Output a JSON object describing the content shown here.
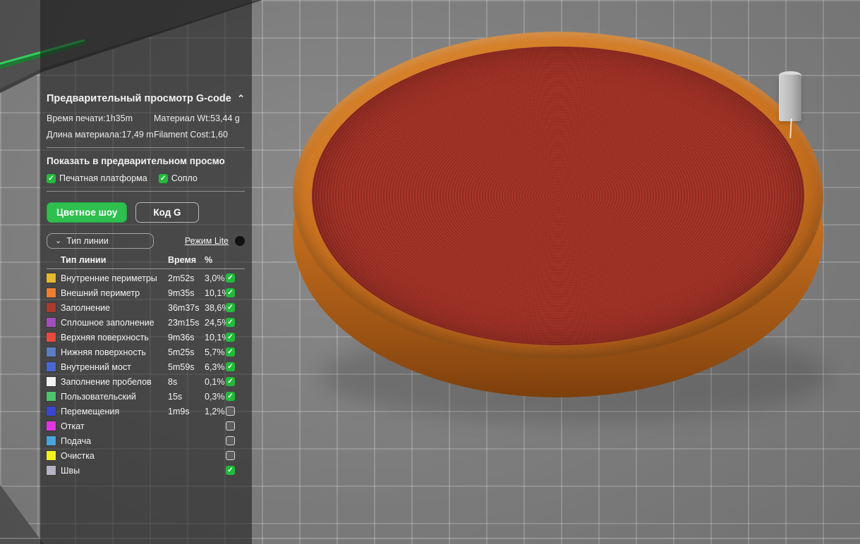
{
  "panel": {
    "title": "Предварительный просмотр G-code",
    "stats": {
      "print_time_label": "Время печати:",
      "print_time": "1h35m",
      "material_wt_label": "Материал Wt:",
      "material_wt": "53,44 g",
      "material_len_label": "Длина материала:",
      "material_len": "17,49 m",
      "filament_cost_label": "Filament Cost:",
      "filament_cost": "1,60"
    },
    "show_in_preview": {
      "heading": "Показать в предварительном просмо",
      "options": [
        {
          "label": "Печатная платформа",
          "checked": true
        },
        {
          "label": "Сопло",
          "checked": true
        }
      ]
    },
    "buttons": {
      "color_show": "Цветное шоу",
      "gcode": "Код G"
    },
    "line_type_dropdown": "Тип линии",
    "mode_lite": "Режим Lite",
    "accent_green": "#23ba3b",
    "button_green": "#2fbf4f",
    "table": {
      "headers": [
        "Тип линии",
        "Время",
        "%"
      ],
      "rows": [
        {
          "color": "#e5b92c",
          "label": "Внутренние периметры",
          "time": "2m52s",
          "pct": "3,0%",
          "checked": true
        },
        {
          "color": "#ee7e30",
          "label": "Внешний периметр",
          "time": "9m35s",
          "pct": "10,1%",
          "checked": true
        },
        {
          "color": "#aa3a2b",
          "label": "Заполнение",
          "time": "36m37s",
          "pct": "38,6%",
          "checked": true
        },
        {
          "color": "#a14ebf",
          "label": "Сплошное заполнение",
          "time": "23m15s",
          "pct": "24,5%",
          "checked": true
        },
        {
          "color": "#ea4a3e",
          "label": "Верхняя поверхность",
          "time": "9m36s",
          "pct": "10,1%",
          "checked": true
        },
        {
          "color": "#5d7dc3",
          "label": "Нижняя поверхность",
          "time": "5m25s",
          "pct": "5,7%",
          "checked": true
        },
        {
          "color": "#4a66d5",
          "label": "Внутренний мост",
          "time": "5m59s",
          "pct": "6,3%",
          "checked": true
        },
        {
          "color": "#f2f2f2",
          "label": "Заполнение пробелов",
          "time": "8s",
          "pct": "0,1%",
          "checked": true
        },
        {
          "color": "#4dc46a",
          "label": "Пользовательский",
          "time": "15s",
          "pct": "0,3%",
          "checked": true
        },
        {
          "color": "#3a46cf",
          "label": "Перемещения",
          "time": "1m9s",
          "pct": "1,2%",
          "checked": false
        },
        {
          "color": "#e335e3",
          "label": "Откат",
          "time": "",
          "pct": "",
          "checked": false
        },
        {
          "color": "#49a6dd",
          "label": "Подача",
          "time": "",
          "pct": "",
          "checked": false
        },
        {
          "color": "#f2f21f",
          "label": "Очистка",
          "time": "",
          "pct": "",
          "checked": false
        },
        {
          "color": "#b4b4c4",
          "label": "Швы",
          "time": "",
          "pct": "",
          "checked": true
        }
      ]
    }
  },
  "viewport": {
    "colors": {
      "plate": "#7d7d7d",
      "rim": "#c9711f",
      "rim-dark": "#7e3f0c",
      "infill": "#a8352b",
      "infill-dark": "#922c21",
      "tower": "#b9b9b9",
      "travel-green": "#2fcf5a",
      "accent": "#23ba3b",
      "btn-green": "#2fbf4f"
    }
  }
}
